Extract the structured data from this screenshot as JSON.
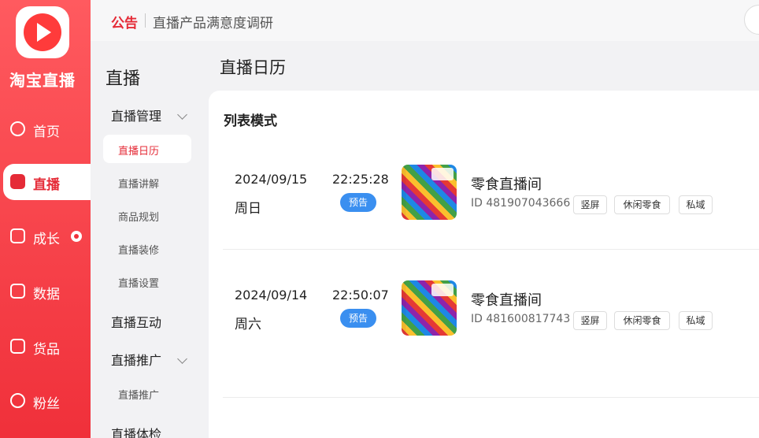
{
  "brand": {
    "name": "淘宝直播",
    "logo_icon": "play-icon"
  },
  "rail": {
    "items": [
      {
        "label": "首页",
        "icon": "home-icon",
        "active": false
      },
      {
        "label": "直播",
        "icon": "live-icon",
        "active": true
      },
      {
        "label": "成长",
        "icon": "growth-icon",
        "active": false,
        "has_dot": true
      },
      {
        "label": "数据",
        "icon": "chart-icon",
        "active": false
      },
      {
        "label": "货品",
        "icon": "goods-icon",
        "active": false
      },
      {
        "label": "粉丝",
        "icon": "fans-icon",
        "active": false
      }
    ]
  },
  "notice": {
    "tag": "公告",
    "text": "直播产品满意度调研"
  },
  "sidebar": {
    "title": "直播",
    "groups": [
      {
        "label": "直播管理",
        "items": [
          "直播日历",
          "直播讲解",
          "商品规划",
          "直播装修",
          "直播设置"
        ]
      },
      {
        "label": "直播互动",
        "items": []
      },
      {
        "label": "直播推广",
        "items": [
          "直播推广"
        ]
      },
      {
        "label": "直播体检",
        "items": []
      }
    ],
    "active_item": "直播日历"
  },
  "page": {
    "title": "直播日历",
    "panel_title": "列表模式"
  },
  "entries": [
    {
      "date": "2024/09/15",
      "weekday": "周日",
      "time": "22:25:28",
      "status": "预告",
      "room": "零食直播间",
      "id": "ID 481907043666",
      "tags": [
        "竖屏",
        "休闲零食",
        "私域"
      ]
    },
    {
      "date": "2024/09/14",
      "weekday": "周六",
      "time": "22:50:07",
      "status": "预告",
      "room": "零食直播间",
      "id": "ID 481600817743",
      "tags": [
        "竖屏",
        "休闲零食",
        "私域"
      ]
    }
  ],
  "colors": {
    "brand_red": "#f0303a",
    "accent_red": "#e52b37",
    "badge_blue": "#3a8ff0"
  }
}
